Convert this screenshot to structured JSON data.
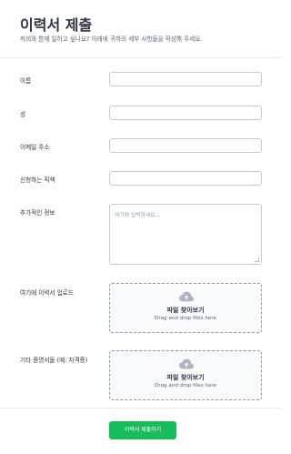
{
  "header": {
    "title": "이력서 제출",
    "subtitle": "저희와 함께 일하고 싶나요? 아래에 귀하의 세부 사항들을 작성해 주세요."
  },
  "form": {
    "first_name_label": "이름",
    "last_name_label": "성",
    "email_label": "이메일 주소",
    "position_label": "신청하는 직책",
    "additional_info_label": "추가적인 정보",
    "additional_info_placeholder": "여기에 입력하세요...",
    "resume_upload_label": "여기에 이력서 업로드",
    "certificates_upload_label": "기타 증명서들 (예: 자격증)",
    "upload_button_label": "파일 찾아보기",
    "upload_hint": "Drag and drop files here"
  },
  "footer": {
    "submit_label": "이력서 제출하기"
  },
  "colors": {
    "accent": "#18bd5b",
    "text": "#2c3345",
    "border": "#c3cad8"
  }
}
